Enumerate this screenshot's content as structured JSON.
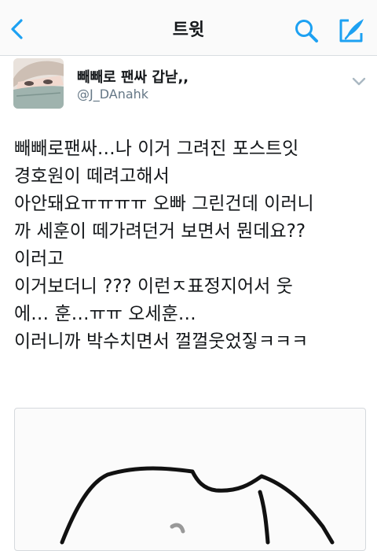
{
  "nav": {
    "title": "트윗",
    "accent_color": "#1da1f2",
    "icons": [
      "back-chevron-icon",
      "search-icon",
      "compose-icon"
    ]
  },
  "tweet": {
    "display_name": "빼빼로 팬싸 갑낟,,",
    "handle": "@J_DAnahk",
    "lines": [
      "빼빼로팬싸…나 이거 그려진 포스트잇",
      "경호원이 떼려고해서",
      "아안돼요ㅠㅠㅠㅠ 오빠 그린건데 이러니",
      "까 세훈이 떼가려던거 보면서 뭔데요??",
      "이러고",
      "이거보더니 ??? 이런ㅈ표정지어서 웃",
      "에… 훈…ㅠㅠ 오세훈…",
      "이러니까 박수치면서 껄껄웃었짛ㅋㅋㅋ"
    ],
    "media": {
      "type": "drawing",
      "description_icon": "sketch-image"
    }
  }
}
